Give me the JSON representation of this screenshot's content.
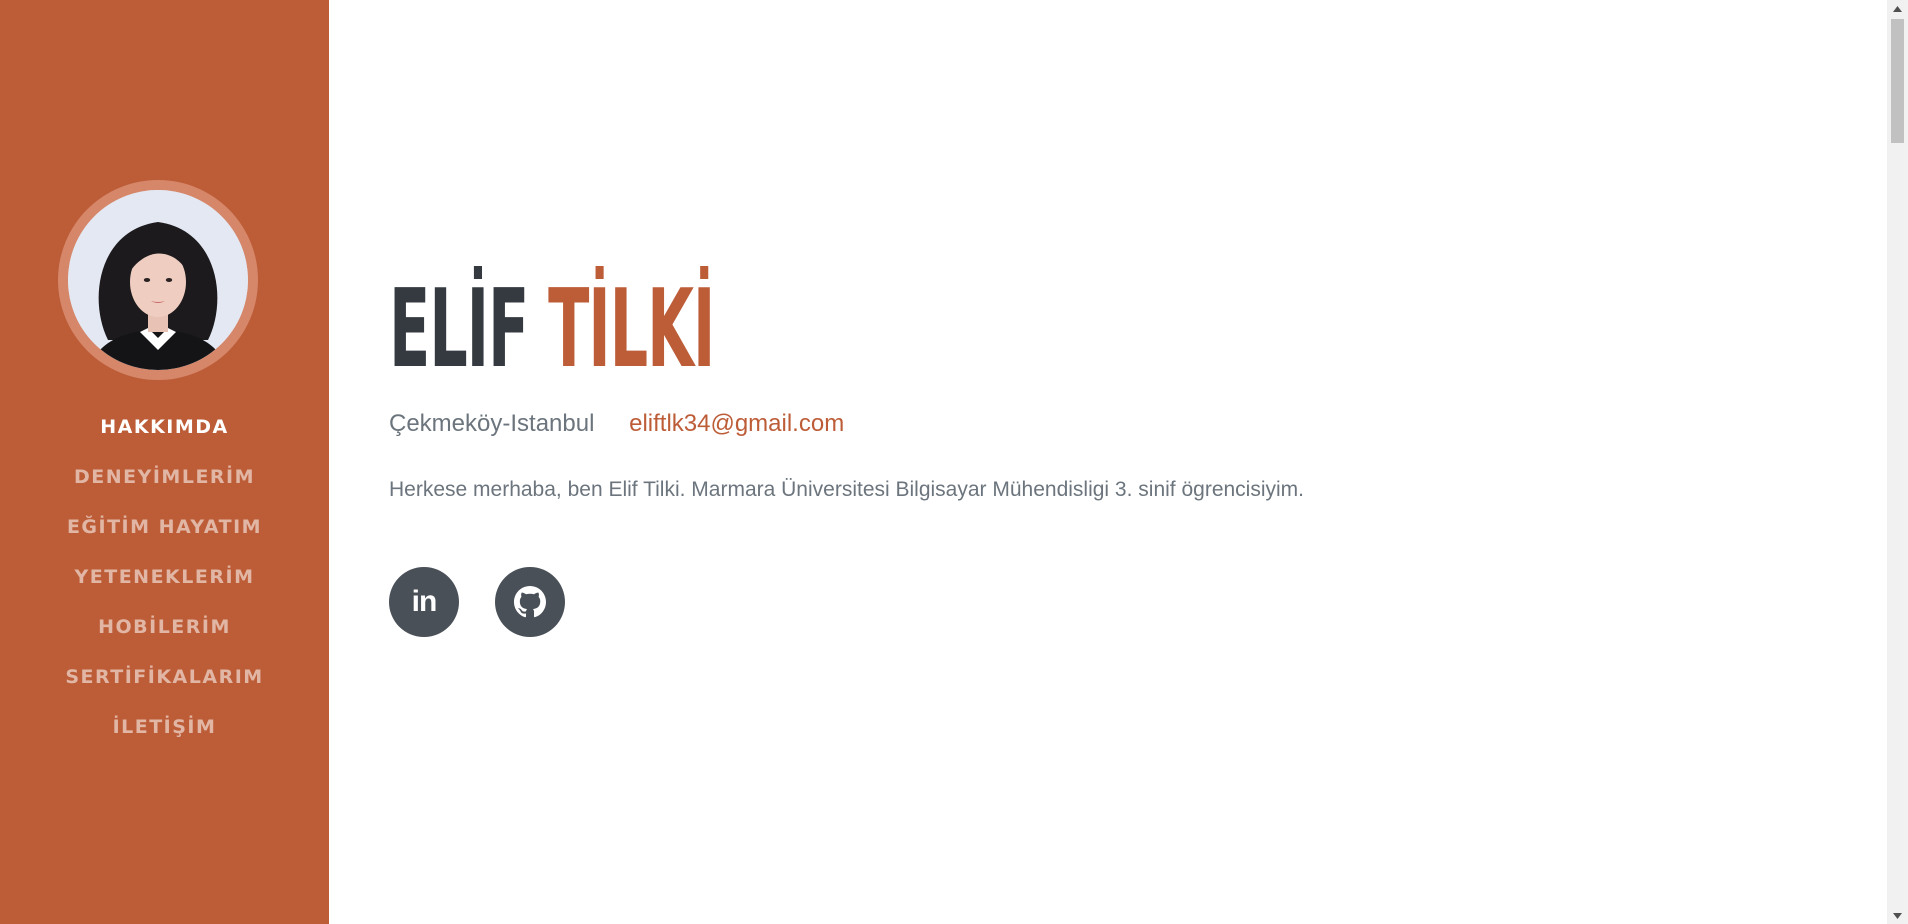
{
  "sidebar": {
    "nav": [
      {
        "label": "HAKKIMDA",
        "active": true
      },
      {
        "label": "DENEYİMLERİM",
        "active": false
      },
      {
        "label": "EĞİTİM HAYATIM",
        "active": false
      },
      {
        "label": "YETENEKLERİM",
        "active": false
      },
      {
        "label": "HOBİLERİM",
        "active": false
      },
      {
        "label": "SERTİFİKALARIM",
        "active": false
      },
      {
        "label": "İLETİŞİM",
        "active": false
      }
    ]
  },
  "about": {
    "first_name": "ELİF",
    "last_name": "TİLKİ",
    "location": "Çekmeköy-Istanbul",
    "email": "eliftlk34@gmail.com",
    "intro": "Herkese merhaba, ben Elif Tilki. Marmara Üniversitesi Bilgisayar Mühendisligi 3. sinif ögrencisiyim.",
    "social": [
      {
        "icon": "linkedin-icon"
      },
      {
        "icon": "github-icon"
      }
    ]
  },
  "colors": {
    "primary": "#bd5d38",
    "dark": "#343a40",
    "muted": "#6c757d",
    "social_bg": "#495057"
  }
}
